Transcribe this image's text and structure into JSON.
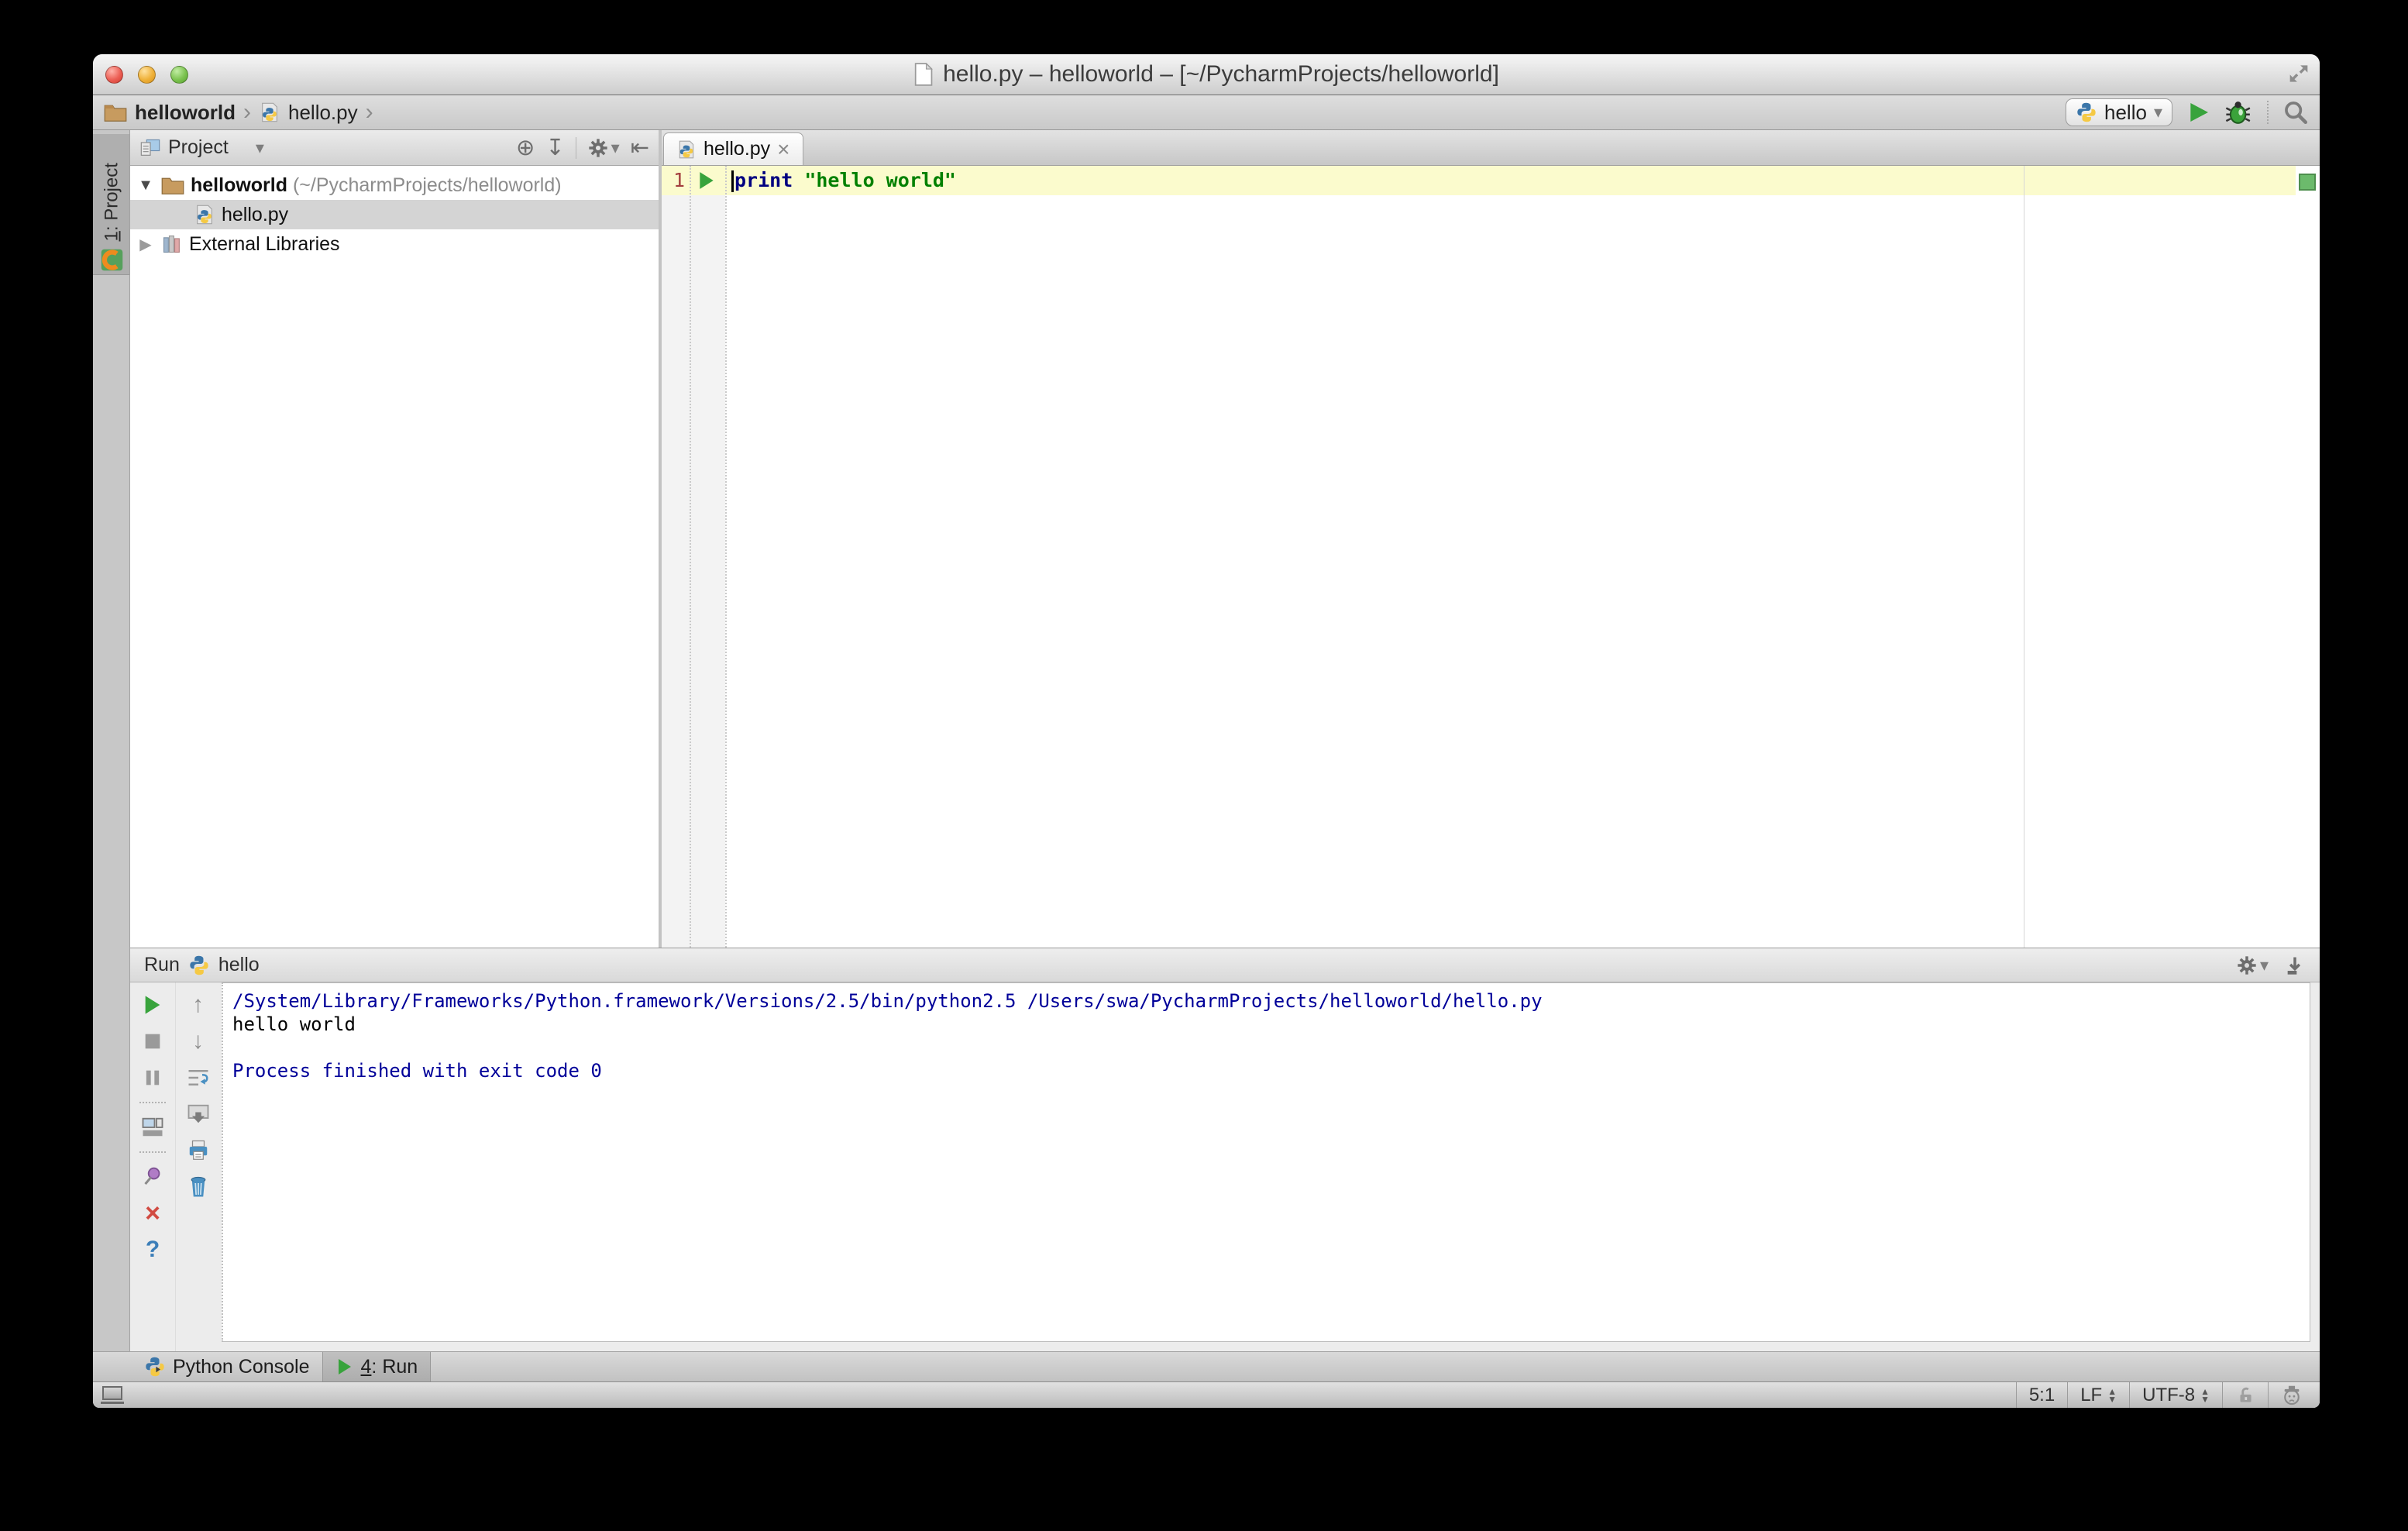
{
  "window": {
    "title": "hello.py – helloworld – [~/PycharmProjects/helloworld]"
  },
  "toolbar": {
    "breadcrumbs": {
      "project": "helloworld",
      "file": "hello.py",
      "chevron": "›"
    },
    "run_config": {
      "label": "hello",
      "arrow": "▾"
    }
  },
  "stripe": {
    "tab_num": "1",
    "tab_label": ": Project"
  },
  "project_panel": {
    "header": {
      "title": "Project",
      "arrow": "▾",
      "locate_icon": "⊕",
      "collapse_icon": "↧",
      "gear_arrow": "▾",
      "hide_icon": "⇤"
    },
    "tree": [
      {
        "expand": "▼",
        "name": "helloworld",
        "detail": " (~/PycharmProjects/helloworld)"
      },
      {
        "name": "hello.py"
      },
      {
        "expand": "▶",
        "name": "External Libraries"
      }
    ]
  },
  "editor": {
    "tab": {
      "label": "hello.py",
      "close": "×"
    },
    "line": {
      "number": "1",
      "keyword": "print ",
      "string": "\"hello world\""
    }
  },
  "run_panel": {
    "header": {
      "label": "Run",
      "config": "hello",
      "gear_arrow": "▾"
    },
    "toolbar": {
      "up": "↑",
      "down": "↓",
      "soft_wrap": "⇆",
      "close": "×",
      "help": "?"
    },
    "console_lines": [
      "/System/Library/Frameworks/Python.framework/Versions/2.5/bin/python2.5 /Users/swa/PycharmProjects/helloworld/hello.py",
      "hello world",
      "",
      "Process finished with exit code 0"
    ]
  },
  "bottom_bar": {
    "python_console": "Python Console",
    "run_num": "4",
    "run_label": ": Run"
  },
  "status_bar": {
    "position": "5:1",
    "line_ending": "LF",
    "encoding": "UTF-8"
  },
  "colors": {
    "accent_green": "#3BA33B",
    "keyword": "#000080",
    "string": "#008000",
    "console_system": "#000099",
    "line_highlight": "#FBFBCD"
  }
}
